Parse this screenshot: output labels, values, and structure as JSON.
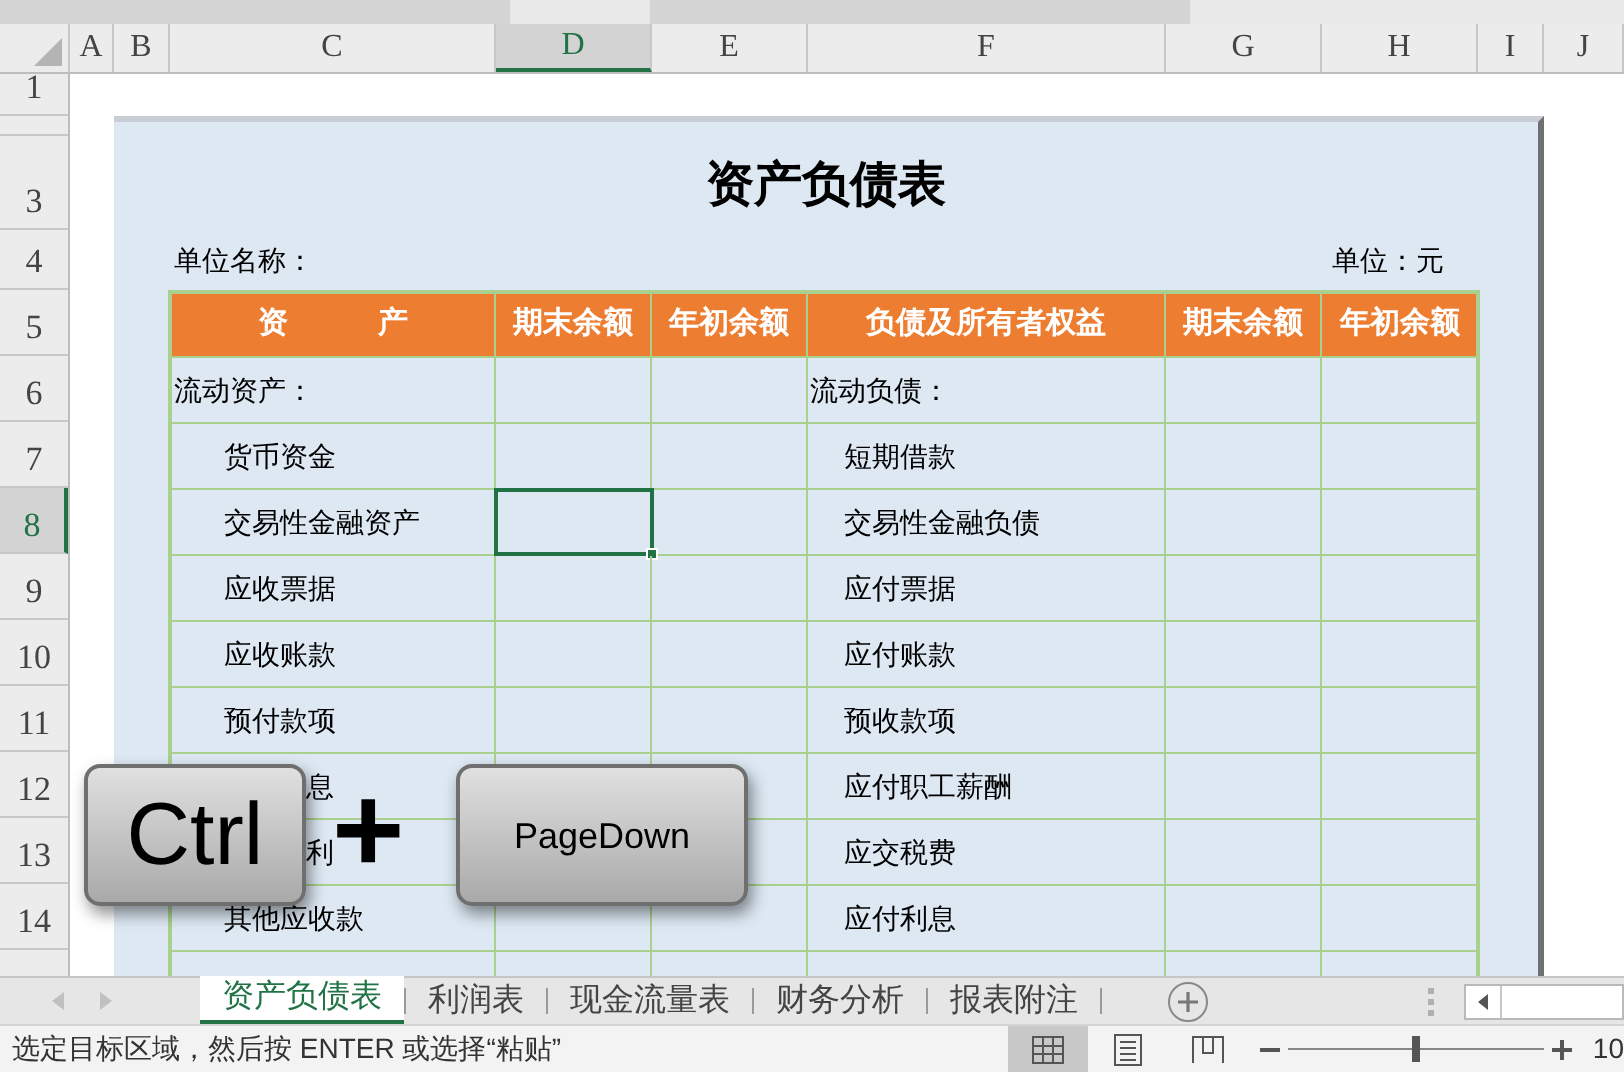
{
  "column_headers": [
    {
      "label": "A",
      "selected": false
    },
    {
      "label": "B",
      "selected": false
    },
    {
      "label": "C",
      "selected": false
    },
    {
      "label": "D",
      "selected": true
    },
    {
      "label": "E",
      "selected": false
    },
    {
      "label": "F",
      "selected": false
    },
    {
      "label": "G",
      "selected": false
    },
    {
      "label": "H",
      "selected": false
    },
    {
      "label": "I",
      "selected": false
    },
    {
      "label": "J",
      "selected": false
    }
  ],
  "row_headers": [
    {
      "label": "1",
      "selected": false
    },
    {
      "label": "3",
      "selected": false
    },
    {
      "label": "4",
      "selected": false
    },
    {
      "label": "5",
      "selected": false
    },
    {
      "label": "6",
      "selected": false
    },
    {
      "label": "7",
      "selected": false
    },
    {
      "label": "8",
      "selected": true
    },
    {
      "label": "9",
      "selected": false
    },
    {
      "label": "10",
      "selected": false
    },
    {
      "label": "11",
      "selected": false
    },
    {
      "label": "12",
      "selected": false
    },
    {
      "label": "13",
      "selected": false
    },
    {
      "label": "14",
      "selected": false
    }
  ],
  "sheet": {
    "title": "资产负债表",
    "unit_name_label": "单位名称：",
    "unit_label": "单位：元",
    "table": {
      "columns": [
        "资　　　产",
        "期末余额",
        "年初余额",
        "负债及所有者权益",
        "期末余额",
        "年初余额"
      ],
      "rows": [
        {
          "asset": {
            "text": "流动资产：",
            "kind": "section"
          },
          "liability": {
            "text": "流动负债：",
            "kind": "section"
          },
          "asset_end_selected": false
        },
        {
          "asset": {
            "text": "货币资金",
            "kind": "item"
          },
          "liability": {
            "text": "短期借款",
            "kind": "item"
          },
          "asset_end_selected": false
        },
        {
          "asset": {
            "text": "交易性金融资产",
            "kind": "item"
          },
          "liability": {
            "text": "交易性金融负债",
            "kind": "item"
          },
          "asset_end_selected": true
        },
        {
          "asset": {
            "text": "应收票据",
            "kind": "item"
          },
          "liability": {
            "text": "应付票据",
            "kind": "item"
          },
          "asset_end_selected": false
        },
        {
          "asset": {
            "text": "应收账款",
            "kind": "item"
          },
          "liability": {
            "text": "应付账款",
            "kind": "item"
          },
          "asset_end_selected": false
        },
        {
          "asset": {
            "text": "预付款项",
            "kind": "item"
          },
          "liability": {
            "text": "预收款项",
            "kind": "item"
          },
          "asset_end_selected": false
        },
        {
          "asset": {
            "text": "息",
            "kind": "covered"
          },
          "liability": {
            "text": "应付职工薪酬",
            "kind": "item"
          },
          "asset_end_selected": false
        },
        {
          "asset": {
            "text": "利",
            "kind": "covered"
          },
          "liability": {
            "text": "应交税费",
            "kind": "item"
          },
          "asset_end_selected": false
        },
        {
          "asset": {
            "text": "其他应收款",
            "kind": "item"
          },
          "liability": {
            "text": "应付利息",
            "kind": "item"
          },
          "asset_end_selected": false
        }
      ]
    }
  },
  "shortcut": {
    "keys": [
      "Ctrl",
      "PageDown"
    ],
    "joiner": "+"
  },
  "sheet_tabs": [
    {
      "label": "资产负债表",
      "selected": true
    },
    {
      "label": "利润表",
      "selected": false
    },
    {
      "label": "现金流量表",
      "selected": false
    },
    {
      "label": "财务分析",
      "selected": false
    },
    {
      "label": "报表附注",
      "selected": false
    }
  ],
  "status_bar": {
    "message": "选定目标区域，然后按 ENTER 或选择“粘贴”",
    "view_buttons": [
      {
        "kind": "normal",
        "selected": true
      },
      {
        "kind": "page_layout",
        "selected": false
      },
      {
        "kind": "page_break",
        "selected": false
      }
    ],
    "zoom": {
      "level": 0.5,
      "reading": "10"
    }
  }
}
